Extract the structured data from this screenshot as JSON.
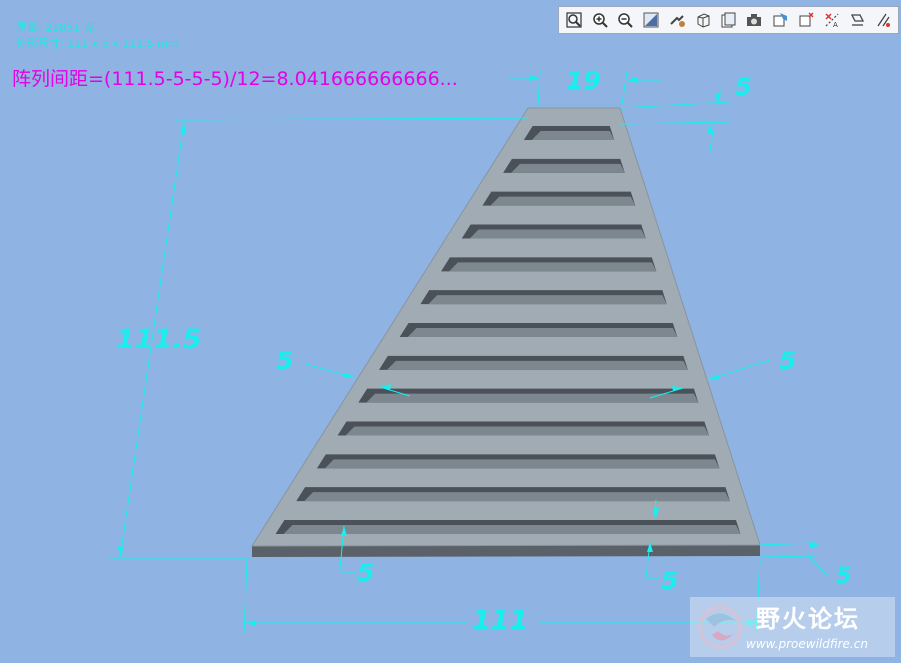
{
  "info": {
    "mass": "质量: 21851 克",
    "size": "外形尺寸: 111 x 5 x 111.5 mm"
  },
  "formula": "阵列间距=(111.5-5-5-5)/12=8.041666666666...",
  "dimensions": {
    "top_width": "19",
    "top_border": "5",
    "height": "111.5",
    "left_border": "5",
    "right_border": "5",
    "bottom_left": "5",
    "bottom_mid": "5",
    "bottom_right": "5",
    "bottom_width": "111"
  },
  "model": {
    "slot_count": 13,
    "plate_color": "#a0abb4",
    "slot_color": "#4a5158",
    "dimension_color": "#18efef"
  },
  "toolbar": [
    {
      "name": "zoom-fit-icon"
    },
    {
      "name": "zoom-in-icon"
    },
    {
      "name": "zoom-out-icon"
    },
    {
      "name": "zoom-window-icon"
    },
    {
      "name": "pan-icon"
    },
    {
      "name": "view-orientation-icon"
    },
    {
      "name": "saved-views-icon"
    },
    {
      "name": "camera-icon"
    },
    {
      "name": "display-style-icon"
    },
    {
      "name": "datum-display-icon"
    },
    {
      "name": "datum-axes-icon"
    },
    {
      "name": "annotation-icon"
    },
    {
      "name": "spin-center-icon"
    }
  ],
  "watermark": {
    "title": "野火论坛",
    "url": "www.proewildfire.cn"
  }
}
